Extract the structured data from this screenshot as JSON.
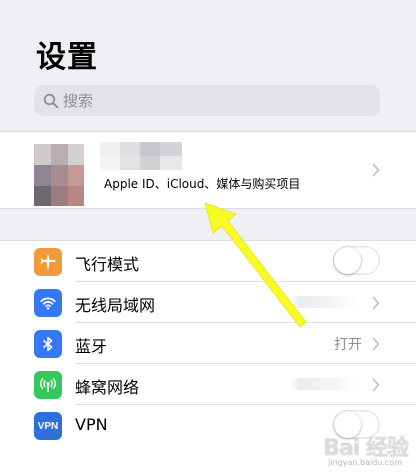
{
  "header": {
    "title": "设置"
  },
  "search": {
    "placeholder": "搜索",
    "icon": "search-icon"
  },
  "account": {
    "subtitle": "Apple ID、iCloud、媒体与购买项目",
    "chevron_icon": "chevron-right-icon"
  },
  "settings": {
    "items": [
      {
        "label": "飞行模式",
        "icon": "airplane-icon",
        "icon_color": "#f19a37",
        "control": "toggle",
        "on": false
      },
      {
        "label": "无线局域网",
        "icon": "wifi-icon",
        "icon_color": "#3478f6",
        "control": "chevron",
        "value_blurred": true
      },
      {
        "label": "蓝牙",
        "icon": "bluetooth-icon",
        "icon_color": "#3478f6",
        "control": "chevron",
        "value": "打开"
      },
      {
        "label": "蜂窝网络",
        "icon": "cellular-icon",
        "icon_color": "#34c759",
        "control": "chevron",
        "value_blurred": true
      },
      {
        "label": "VPN",
        "icon": "vpn-icon",
        "icon_color": "#2f6fdc",
        "icon_text": "VPN",
        "control": "toggle",
        "on": false
      }
    ]
  },
  "annotation": {
    "arrow_color": "#f6fa25"
  },
  "watermark": {
    "text": "Bai 经验",
    "subtext": "jingyan.baidu.com"
  }
}
